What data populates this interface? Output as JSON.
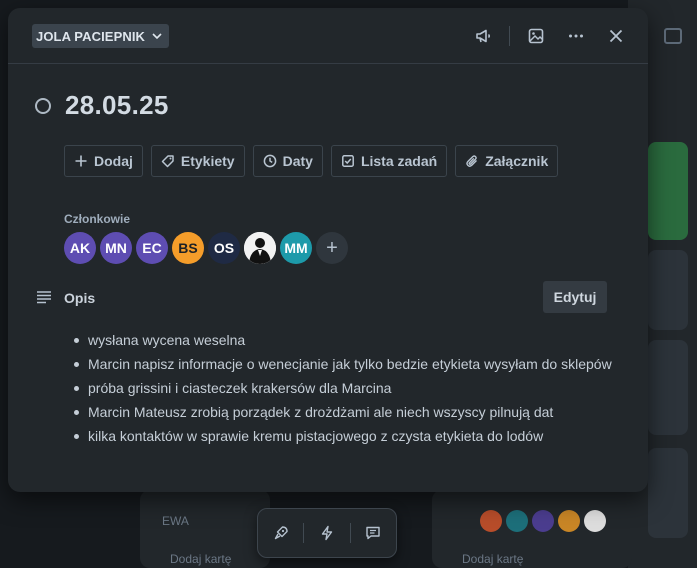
{
  "header": {
    "list_name": "JOLA PACIEPNIK",
    "icons": [
      "megaphone-icon",
      "image-icon",
      "more-icon",
      "close-icon"
    ]
  },
  "card": {
    "title": "28.05.25"
  },
  "actions": [
    {
      "label": "Dodaj",
      "icon": "plus-icon"
    },
    {
      "label": "Etykiety",
      "icon": "tag-icon"
    },
    {
      "label": "Daty",
      "icon": "clock-icon"
    },
    {
      "label": "Lista zadań",
      "icon": "checklist-icon"
    },
    {
      "label": "Załącznik",
      "icon": "paperclip-icon"
    }
  ],
  "members": {
    "label": "Członkowie",
    "avatars": [
      {
        "initials": "AK",
        "color": "#5e4db2"
      },
      {
        "initials": "MN",
        "color": "#5e4db2"
      },
      {
        "initials": "EC",
        "color": "#5e4db2"
      },
      {
        "initials": "BS",
        "color": "#f59d2a"
      },
      {
        "initials": "OS",
        "color": "#1f2a44"
      },
      {
        "initials": "",
        "color": "#ffffff",
        "photo": true
      },
      {
        "initials": "MM",
        "color": "#1d9aaa"
      }
    ],
    "add_label": "+"
  },
  "description": {
    "title": "Opis",
    "edit_label": "Edytuj",
    "items": [
      "wysłana wycena weselna",
      "Marcin napisz informacje o wenecjanie jak tylko bedzie etykieta wysyłam  do sklepów",
      "próba grissini i ciasteczek krakersów dla Marcina",
      "Marcin Mateusz zrobią porządek z drożdżami ale niech wszyscy pilnują dat",
      "kilka kontaktów w sprawie kremu pistacjowego z czysta etykieta do lodów"
    ]
  },
  "toolbar": {
    "icons": [
      "rocket-icon",
      "lightning-icon",
      "comment-icon"
    ]
  },
  "background": {
    "card_text": "EWA",
    "add_card_label": "Dodaj kartę"
  }
}
